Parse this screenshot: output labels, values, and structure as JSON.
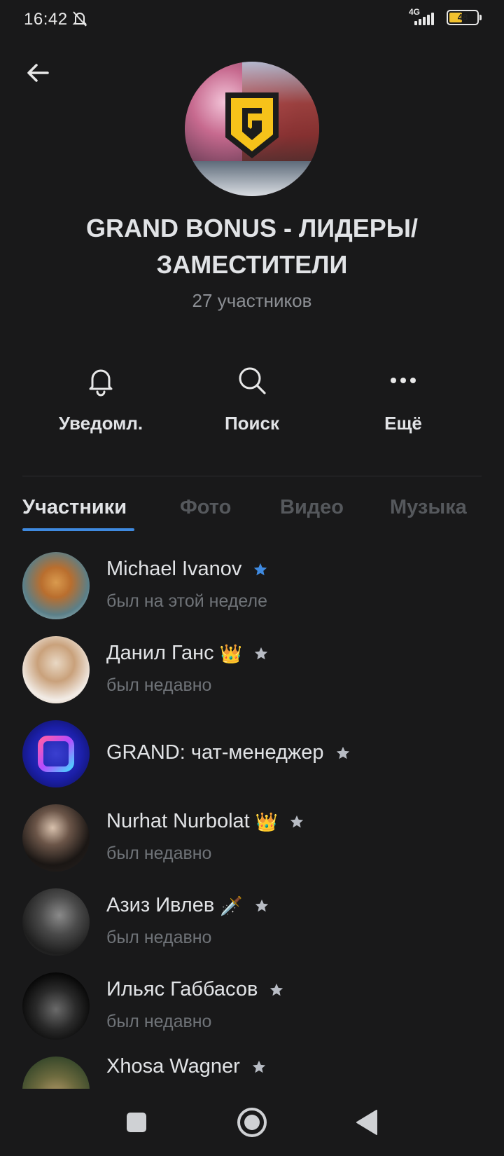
{
  "status_bar": {
    "time": "16:42",
    "network": "4G",
    "battery": "48",
    "battery_level": 0.48
  },
  "header": {
    "title": "GRAND BONUS - ЛИДЕРЫ/ ЗАМЕСТИТЕЛИ",
    "subtitle": "27 участников"
  },
  "actions": [
    {
      "label": "Уведомл.",
      "icon": "bell-icon"
    },
    {
      "label": "Поиск",
      "icon": "search-icon"
    },
    {
      "label": "Ещё",
      "icon": "more-icon"
    }
  ],
  "tabs": [
    {
      "label": "Участники",
      "active": true
    },
    {
      "label": "Фото",
      "active": false
    },
    {
      "label": "Видео",
      "active": false
    },
    {
      "label": "Музыка",
      "active": false
    }
  ],
  "members": [
    {
      "name": "Michael Ivanov",
      "emoji": "",
      "status": "был на этой неделе",
      "star_color": "#3f8ae0"
    },
    {
      "name": "Данил Ганс",
      "emoji": "👑",
      "status": "был недавно",
      "star_color": "#b8bcc4"
    },
    {
      "name": "GRAND: чат-менеджер",
      "emoji": "",
      "status": "",
      "star_color": "#b8bcc4"
    },
    {
      "name": "Nurhat Nurbolat",
      "emoji": "👑",
      "status": "был недавно",
      "star_color": "#b8bcc4"
    },
    {
      "name": "Азиз Ивлев",
      "emoji": "🗡️",
      "status": "был недавно",
      "star_color": "#b8bcc4"
    },
    {
      "name": "Ильяс Габбасов",
      "emoji": "",
      "status": "был недавно",
      "star_color": "#b8bcc4"
    },
    {
      "name": "Xhosa Wagner",
      "emoji": "",
      "status": "",
      "star_color": "#b8bcc4"
    }
  ],
  "colors": {
    "background": "#19191a",
    "accent": "#3f8ae0"
  }
}
